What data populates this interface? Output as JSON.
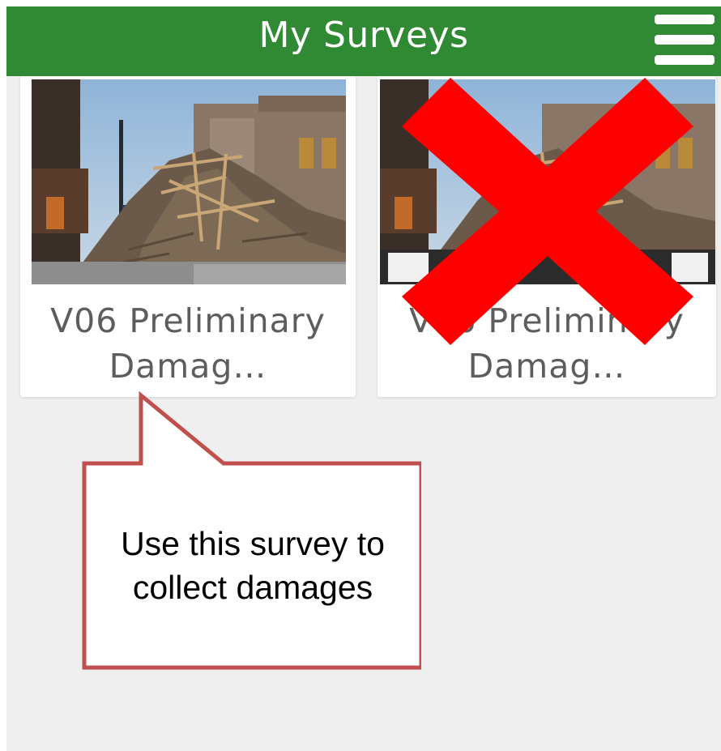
{
  "header": {
    "title": "My Surveys",
    "menu_icon": "hamburger-menu-icon",
    "background_color": "#2f8a33"
  },
  "surveys": [
    {
      "title": "V06 Preliminary Damag…",
      "thumbnail": "storm-damaged-buildings-photo"
    },
    {
      "title": "V06 Preliminary Damag…",
      "thumbnail": "storm-damaged-buildings-photo"
    }
  ],
  "annotations": {
    "strike_icon": "red-x-icon",
    "strike_color": "#ff0000",
    "callout_text": "Use this survey to collect damages",
    "callout_border_color": "#c0504d"
  }
}
